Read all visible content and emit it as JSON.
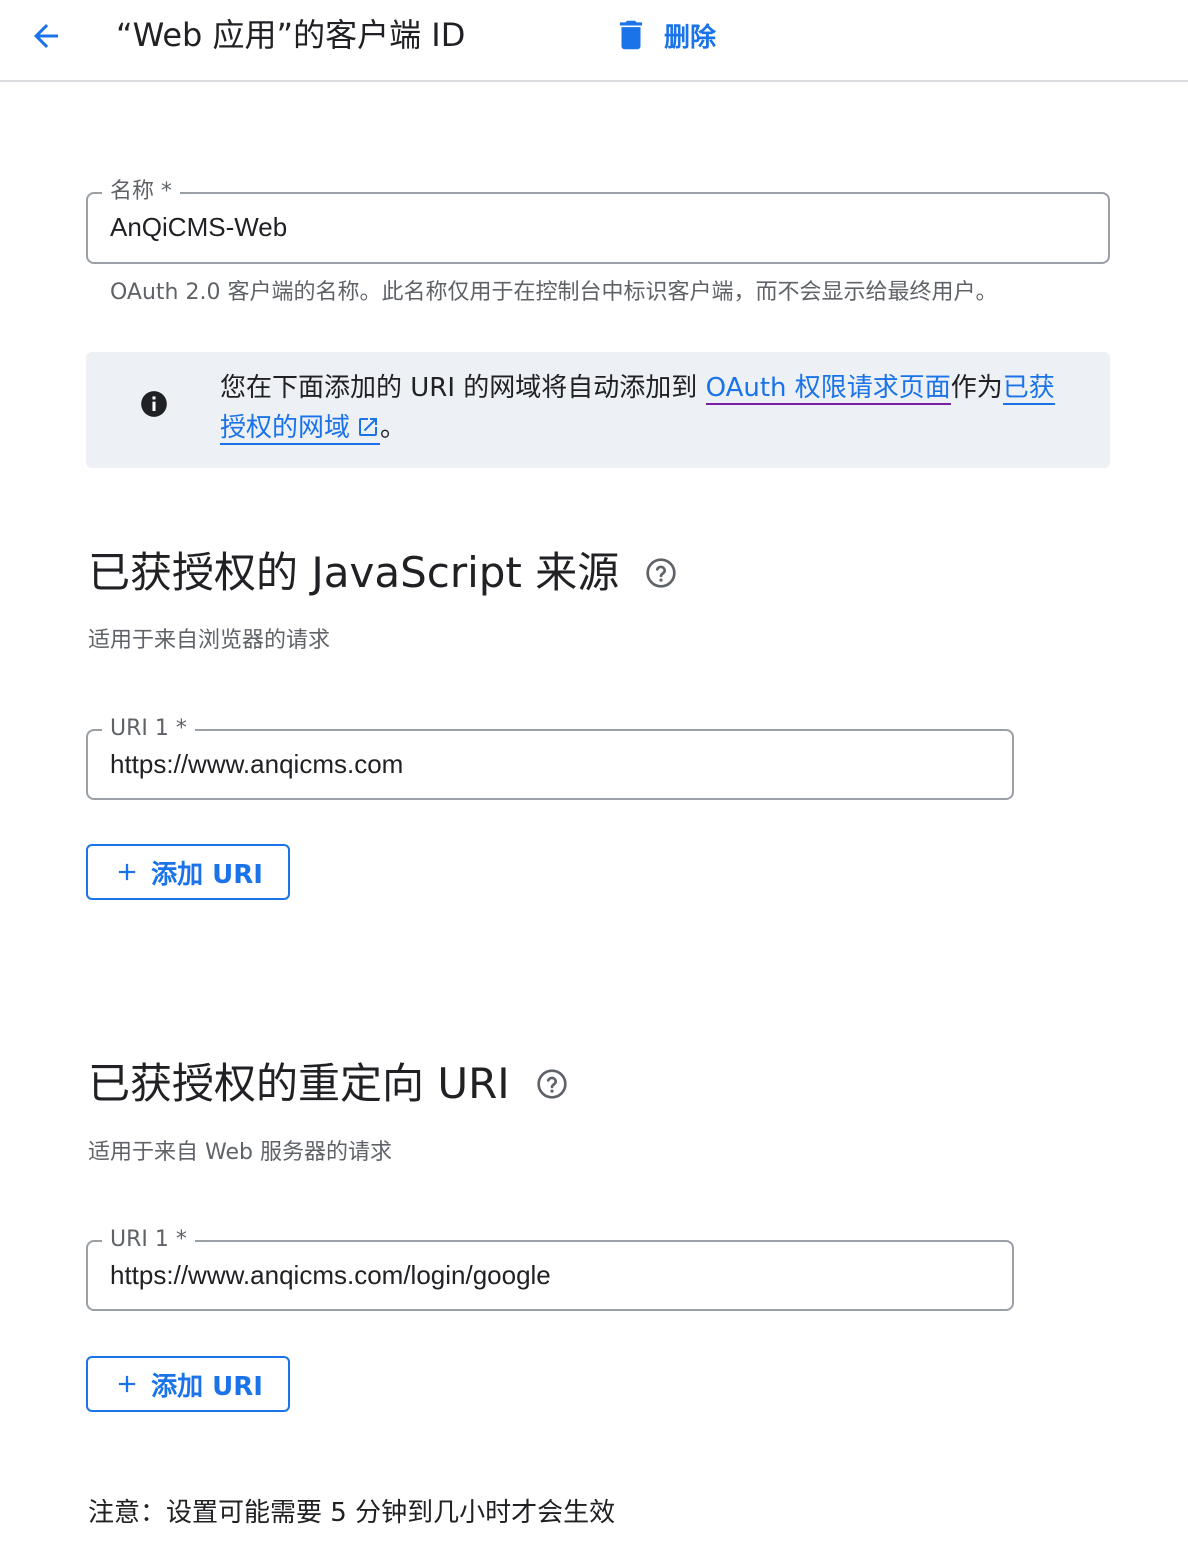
{
  "header": {
    "title": "“Web 应用”的客户端 ID",
    "back_icon": "arrow-back-icon",
    "delete_label": "删除",
    "delete_icon": "trash-icon"
  },
  "name_field": {
    "label": "名称 *",
    "value": "AnQiCMS-Web",
    "hint": "OAuth 2.0 客户端的名称。此名称仅用于在控制台中标识客户端，而不会显示给最终用户。"
  },
  "banner": {
    "icon": "info-icon",
    "text_before": "您在下面添加的 URI 的网域将自动添加到 ",
    "link1": "OAuth 权限请求页面",
    "text_middle": "作为",
    "link2": "已获授权的网域",
    "link2_icon": "open-in-new-icon",
    "text_end": "。"
  },
  "js_origins": {
    "title": "已获授权的 JavaScript 来源",
    "help_icon": "help-icon",
    "subtitle": "适用于来自浏览器的请求",
    "uri_label": "URI 1 *",
    "uri_value": "https://www.anqicms.com",
    "add_label": "添加 URI"
  },
  "redirect_uris": {
    "title": "已获授权的重定向 URI",
    "help_icon": "help-icon",
    "subtitle": "适用于来自 Web 服务器的请求",
    "uri_label": "URI 1 *",
    "uri_value": "https://www.anqicms.com/login/google",
    "add_label": "添加 URI"
  },
  "note": "注意：设置可能需要 5 分钟到几小时才会生效",
  "colors": {
    "accent": "#1a73e8",
    "visited_link_underline": "#7b1fa2",
    "banner_bg": "#edf0f5",
    "border": "#9aa0a6"
  }
}
